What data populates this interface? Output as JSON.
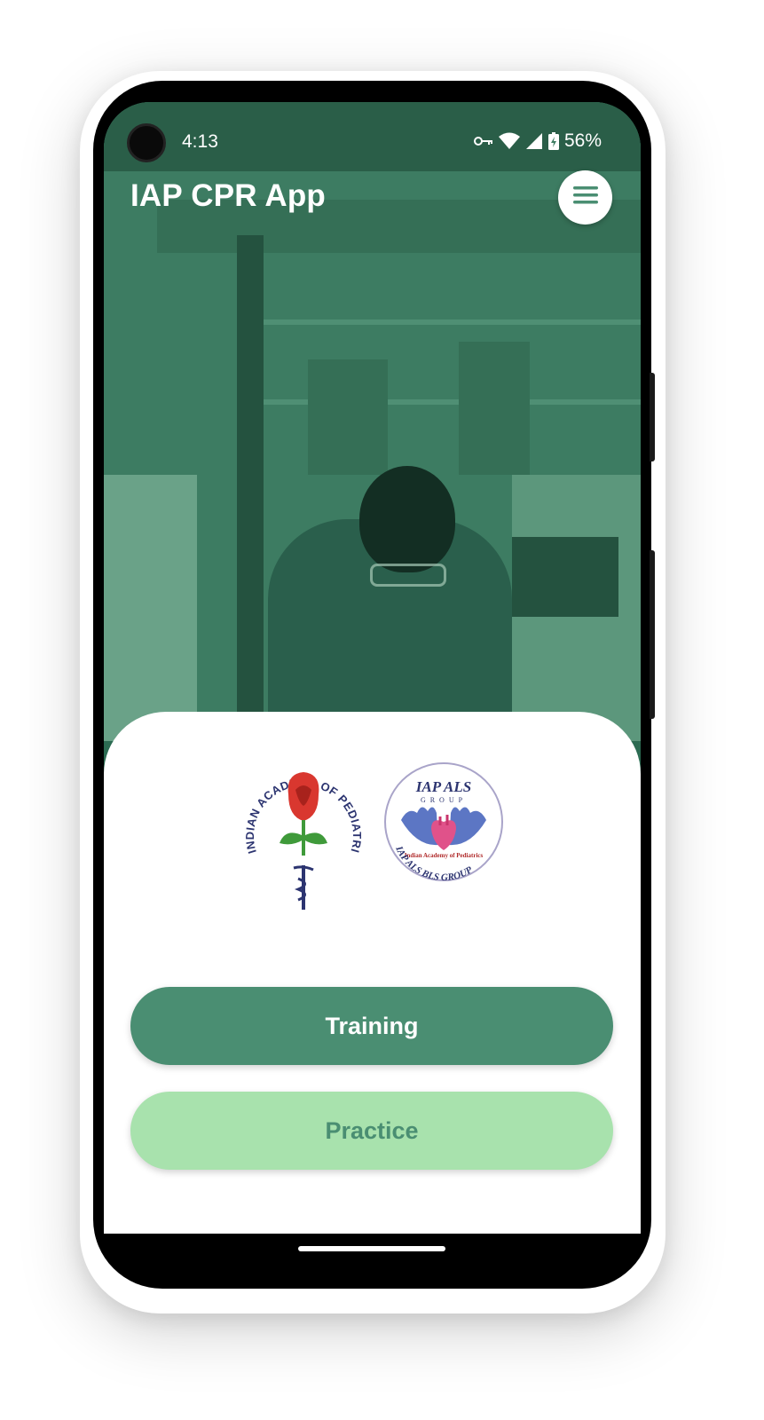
{
  "status_bar": {
    "time": "4:13",
    "battery": "56%",
    "icons": [
      "vpn-key-icon",
      "wifi-icon",
      "cell-signal-icon",
      "battery-charging-icon"
    ]
  },
  "app_bar": {
    "title": "IAP CPR App",
    "menu_icon": "hamburger-menu-icon"
  },
  "logos": {
    "iap": {
      "ring_text": "INDIAN ACADEMY OF PEDIATRICS",
      "emblem": "rose-and-caduceus"
    },
    "als": {
      "title": "IAP ALS",
      "subtitle": "GROUP",
      "inner_text": "Indian Academy of Pediatrics",
      "ring_text": "IAP ALS BLS GROUP"
    }
  },
  "actions": {
    "training_label": "Training",
    "practice_label": "Practice"
  },
  "colors": {
    "primary": "#4a8e72",
    "secondary": "#a8e2ad",
    "hero_tint": "#3d7c62"
  }
}
